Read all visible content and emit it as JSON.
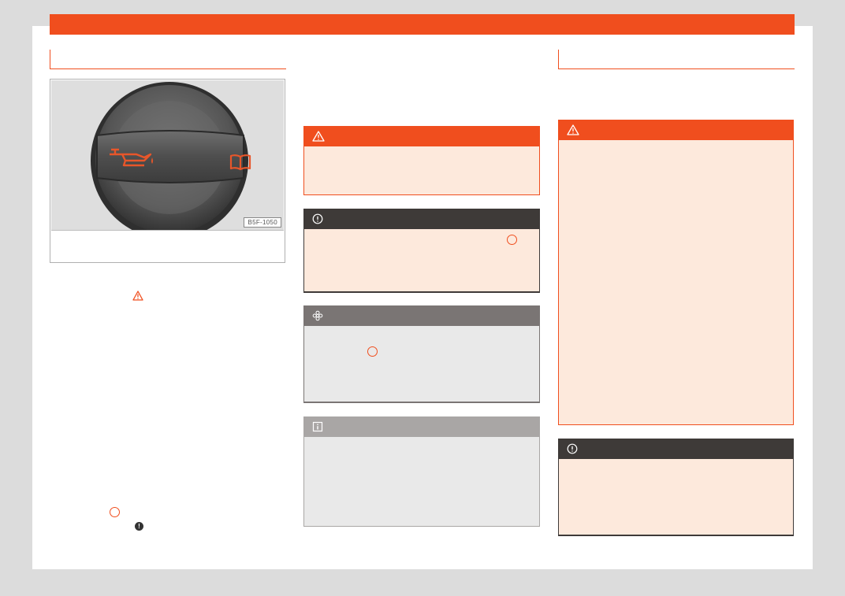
{
  "figure": {
    "code": "B5F-1050",
    "icons": [
      "oil-can-icon",
      "manual-book-icon"
    ]
  },
  "markers": {
    "warning_icon": "warning-triangle-icon",
    "caution_icon": "exclamation-icon",
    "environment_icon": "flower-icon",
    "info_icon": "info-icon"
  },
  "colors": {
    "accent": "#f04e1e",
    "warning_fill": "#fde9dc",
    "note_header": "#3e3a38",
    "env_header": "#7a7574",
    "info_header": "#a9a6a5",
    "neutral_fill": "#e9e9e9"
  }
}
